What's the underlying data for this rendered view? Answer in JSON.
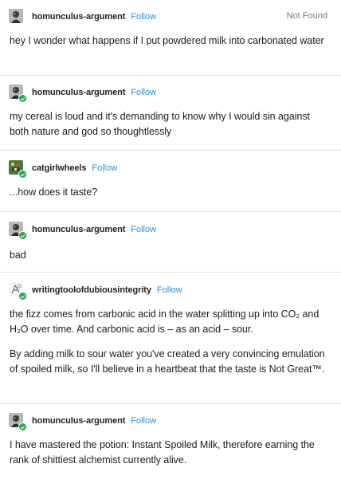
{
  "posts": [
    {
      "username": "homunculus-argument",
      "follow": "Follow",
      "status": "Not Found",
      "avatar_icon": "goblin-avatar-icon",
      "paragraphs": [
        "hey I wonder what happens if I put powdered milk into carbonated water"
      ]
    },
    {
      "username": "homunculus-argument",
      "follow": "Follow",
      "avatar_icon": "goblin-avatar-icon",
      "paragraphs": [
        "my cereal is loud and it's demanding to know why I would sin against both nature and god so thoughtlessly"
      ]
    },
    {
      "username": "catgirlwheels",
      "follow": "Follow",
      "avatar_icon": "pixel-art-avatar-icon",
      "paragraphs": [
        "...how does it taste?"
      ]
    },
    {
      "username": "homunculus-argument",
      "follow": "Follow",
      "avatar_icon": "goblin-avatar-icon",
      "paragraphs": [
        "bad"
      ]
    },
    {
      "username": "writingtoolofdubiousintegrity",
      "follow": "Follow",
      "avatar_icon": "sketch-avatar-icon",
      "paragraphs": [
        "the fizz comes from carbonic acid in the water splitting up into CO₂ and H₂O over time. And carbonic acid is – as an acid – sour.",
        "By adding milk to sour water you've created a very convincing emulation of spoiled milk, so I'll believe in a heartbeat that the taste is Not Great™."
      ]
    },
    {
      "username": "homunculus-argument",
      "follow": "Follow",
      "avatar_icon": "goblin-avatar-icon",
      "paragraphs": [
        "I have mastered the potion: Instant Spoiled Milk, therefore earning the rank of shittiest alchemist currently alive."
      ]
    }
  ],
  "colors": {
    "follow": "#2e8ed4",
    "verified_badge": "#2ea44f",
    "separator": "#e3e3e3"
  }
}
